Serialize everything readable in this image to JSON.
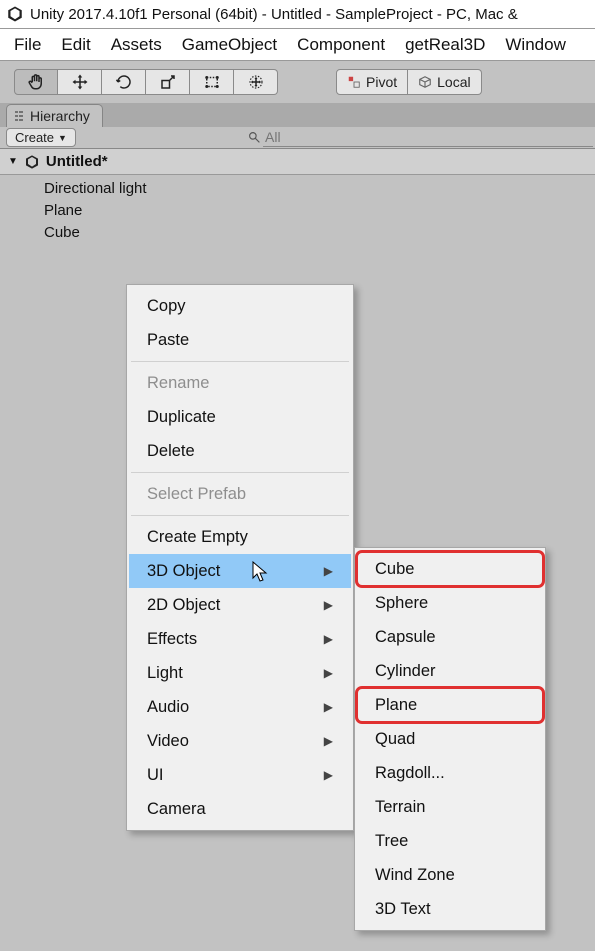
{
  "window": {
    "title": "Unity 2017.4.10f1 Personal (64bit) - Untitled - SampleProject - PC, Mac &"
  },
  "menubar": [
    "File",
    "Edit",
    "Assets",
    "GameObject",
    "Component",
    "getReal3D",
    "Window"
  ],
  "toolbar": {
    "tool_icons": [
      "hand",
      "move",
      "rotate",
      "scale",
      "rect",
      "transform"
    ],
    "pivot_label": "Pivot",
    "local_label": "Local"
  },
  "hierarchy_tab": {
    "label": "Hierarchy"
  },
  "create_btn": "Create",
  "search": {
    "placeholder": "All"
  },
  "scene": {
    "name": "Untitled*"
  },
  "hierarchy_items": [
    "Directional light",
    "Plane",
    "Cube"
  ],
  "context_menu": {
    "items": [
      {
        "label": "Copy",
        "disabled": false,
        "submenu": false
      },
      {
        "label": "Paste",
        "disabled": false,
        "submenu": false
      },
      {
        "sep": true
      },
      {
        "label": "Rename",
        "disabled": true,
        "submenu": false
      },
      {
        "label": "Duplicate",
        "disabled": false,
        "submenu": false
      },
      {
        "label": "Delete",
        "disabled": false,
        "submenu": false
      },
      {
        "sep": true
      },
      {
        "label": "Select Prefab",
        "disabled": true,
        "submenu": false
      },
      {
        "sep": true
      },
      {
        "label": "Create Empty",
        "disabled": false,
        "submenu": false
      },
      {
        "label": "3D Object",
        "disabled": false,
        "submenu": true,
        "highlight": true
      },
      {
        "label": "2D Object",
        "disabled": false,
        "submenu": true
      },
      {
        "label": "Effects",
        "disabled": false,
        "submenu": true
      },
      {
        "label": "Light",
        "disabled": false,
        "submenu": true
      },
      {
        "label": "Audio",
        "disabled": false,
        "submenu": true
      },
      {
        "label": "Video",
        "disabled": false,
        "submenu": true
      },
      {
        "label": "UI",
        "disabled": false,
        "submenu": true
      },
      {
        "label": "Camera",
        "disabled": false,
        "submenu": false
      }
    ]
  },
  "submenu_3d": {
    "items": [
      {
        "label": "Cube",
        "red": true
      },
      {
        "label": "Sphere"
      },
      {
        "label": "Capsule"
      },
      {
        "label": "Cylinder"
      },
      {
        "label": "Plane",
        "red": true
      },
      {
        "label": "Quad"
      },
      {
        "label": "Ragdoll..."
      },
      {
        "label": "Terrain"
      },
      {
        "label": "Tree"
      },
      {
        "label": "Wind Zone"
      },
      {
        "label": "3D Text"
      }
    ]
  }
}
